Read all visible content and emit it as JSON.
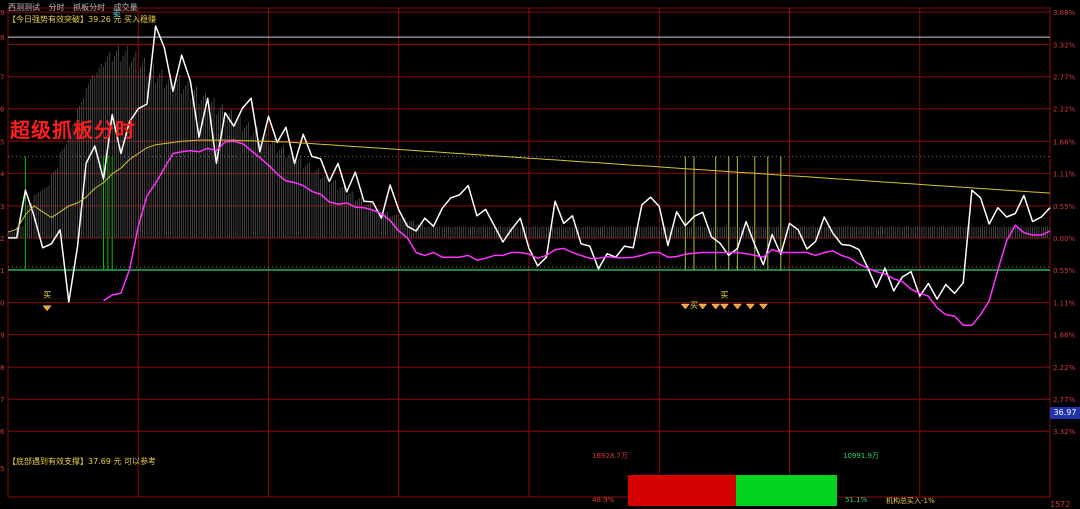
{
  "header": {
    "tab1": "西测测试",
    "tab2": "分时",
    "tab3": "抓板分时",
    "tab4": "成交量"
  },
  "signals": {
    "top": "【今日强势有效突破】39.26 元 买入稳赚",
    "bottom": "【底部遇到有效支撑】37.69 元 可以参考"
  },
  "overlay_title": "超级抓板分时",
  "price_tag": "36.97",
  "bottom_right": "1572",
  "colors": {
    "price": "#ffffff",
    "avg": "#ff33ff",
    "ma_slow": "#d4c233",
    "grid": "#8a0a0a",
    "buy": "#00e000",
    "sell": "#e00000"
  },
  "chart_data": {
    "type": "line",
    "x": [
      0,
      2,
      4,
      6,
      8,
      10,
      12,
      14,
      16,
      18,
      20,
      22,
      24,
      26,
      28,
      30,
      32,
      34,
      36,
      38,
      40,
      42,
      44,
      46,
      48,
      50,
      52,
      54,
      56,
      58,
      60,
      62,
      64,
      66,
      68,
      70,
      72,
      74,
      76,
      78,
      80,
      82,
      84,
      86,
      88,
      90,
      92,
      94,
      96,
      98,
      100,
      102,
      104,
      106,
      108,
      110,
      112,
      114,
      116,
      118,
      120,
      122,
      124,
      126,
      128,
      130,
      132,
      134,
      136,
      138,
      140,
      142,
      144,
      146,
      148,
      150,
      152,
      154,
      156,
      158,
      160,
      162,
      164,
      166,
      168,
      170,
      172,
      174,
      176,
      178,
      180,
      182,
      184,
      186,
      188,
      190,
      192,
      194,
      196,
      198,
      200,
      202,
      204,
      206,
      208,
      210,
      212,
      214,
      216,
      218,
      220,
      222,
      224,
      226,
      228,
      230,
      232,
      234,
      236,
      238,
      240
    ],
    "series": [
      {
        "values": [
          0.0,
          0.0,
          0.82,
          0.38,
          -0.17,
          -0.1,
          0.14,
          -1.1,
          -0.15,
          1.28,
          1.58,
          1.01,
          2.12,
          1.45,
          2.0,
          2.22,
          2.3,
          3.64,
          3.27,
          2.52,
          3.14,
          2.7,
          1.73,
          2.4,
          1.28,
          2.15,
          1.92,
          2.23,
          2.4,
          1.48,
          2.09,
          1.64,
          1.9,
          1.28,
          1.78,
          1.4,
          1.36,
          0.97,
          1.28,
          0.79,
          1.13,
          0.63,
          0.62,
          0.34,
          0.91,
          0.48,
          0.2,
          0.12,
          0.34,
          0.2,
          0.51,
          0.69,
          0.74,
          0.9,
          0.38,
          0.49,
          0.21,
          -0.07,
          0.15,
          0.34,
          -0.18,
          -0.48,
          -0.33,
          0.63,
          0.25,
          0.38,
          -0.1,
          -0.14,
          -0.53,
          -0.27,
          -0.33,
          -0.14,
          -0.17,
          0.57,
          0.7,
          0.54,
          -0.13,
          0.45,
          0.21,
          0.37,
          0.44,
          0.02,
          -0.09,
          -0.3,
          -0.18,
          0.28,
          -0.12,
          -0.46,
          0.06,
          -0.28,
          0.25,
          0.14,
          -0.19,
          -0.06,
          0.36,
          0.08,
          -0.11,
          -0.13,
          -0.2,
          -0.51,
          -0.85,
          -0.52,
          -0.91,
          -0.67,
          -0.58,
          -1.0,
          -0.78,
          -1.05,
          -0.8,
          -0.95,
          -0.77,
          0.82,
          0.69,
          0.24,
          0.52,
          0.36,
          0.42,
          0.73,
          0.28,
          0.36,
          0.52
        ]
      },
      {
        "values": [
          null,
          null,
          null,
          null,
          null,
          null,
          null,
          null,
          null,
          null,
          null,
          -1.08,
          -0.98,
          -0.95,
          -0.54,
          0.2,
          0.72,
          0.94,
          1.2,
          1.45,
          1.48,
          1.5,
          1.48,
          1.54,
          1.5,
          1.65,
          1.66,
          1.62,
          1.5,
          1.38,
          1.25,
          1.1,
          0.98,
          0.95,
          0.9,
          0.8,
          0.75,
          0.62,
          0.58,
          0.6,
          0.53,
          0.52,
          0.48,
          0.42,
          0.3,
          0.12,
          0.0,
          -0.25,
          -0.3,
          -0.25,
          -0.33,
          -0.33,
          -0.33,
          -0.3,
          -0.38,
          -0.35,
          -0.3,
          -0.3,
          -0.25,
          -0.25,
          -0.28,
          -0.35,
          -0.3,
          -0.2,
          -0.18,
          -0.25,
          -0.3,
          -0.35,
          -0.35,
          -0.32,
          -0.34,
          -0.34,
          -0.33,
          -0.3,
          -0.25,
          -0.25,
          -0.33,
          -0.32,
          -0.28,
          -0.26,
          -0.25,
          -0.25,
          -0.25,
          -0.25,
          -0.25,
          -0.27,
          -0.3,
          -0.33,
          -0.2,
          -0.25,
          -0.25,
          -0.25,
          -0.25,
          -0.3,
          -0.25,
          -0.22,
          -0.3,
          -0.35,
          -0.45,
          -0.52,
          -0.58,
          -0.62,
          -0.7,
          -0.75,
          -0.88,
          -0.95,
          -1.0,
          -1.2,
          -1.32,
          -1.34,
          -1.5,
          -1.5,
          -1.32,
          -1.08,
          -0.55,
          -0.05,
          0.22,
          0.09,
          0.05,
          0.05,
          0.12
        ]
      },
      {
        "values": [
          0.1,
          0.15,
          0.4,
          0.55,
          0.45,
          0.35,
          0.45,
          0.55,
          0.6,
          0.7,
          0.85,
          0.95,
          1.1,
          1.2,
          1.35,
          1.45,
          1.55,
          1.6,
          1.62,
          1.64,
          1.66,
          1.67,
          1.68,
          1.68,
          1.68,
          1.68,
          1.68,
          1.67,
          1.67,
          1.66,
          1.66,
          1.65,
          1.65,
          1.64,
          1.63,
          1.62,
          1.61,
          1.6,
          1.59,
          1.58,
          1.57,
          1.56,
          1.55,
          1.54,
          1.53,
          1.52,
          1.51,
          1.5,
          1.49,
          1.48,
          1.47,
          1.46,
          1.45,
          1.44,
          1.43,
          1.42,
          1.41,
          1.4,
          1.39,
          1.38,
          1.37,
          1.36,
          1.35,
          1.34,
          1.33,
          1.32,
          1.31,
          1.3,
          1.29,
          1.28,
          1.27,
          1.26,
          1.25,
          1.24,
          1.23,
          1.22,
          1.21,
          1.2,
          1.19,
          1.18,
          1.17,
          1.16,
          1.15,
          1.14,
          1.13,
          1.12,
          1.11,
          1.1,
          1.09,
          1.08,
          1.07,
          1.06,
          1.05,
          1.04,
          1.03,
          1.02,
          1.01,
          1.0,
          0.99,
          0.98,
          0.97,
          0.96,
          0.95,
          0.94,
          0.93,
          0.92,
          0.91,
          0.9,
          0.89,
          0.88,
          0.87,
          0.86,
          0.85,
          0.84,
          0.83,
          0.82,
          0.81,
          0.8,
          0.79,
          0.78,
          0.77
        ]
      }
    ],
    "volume_histogram": [
      0.1,
      0.2,
      0.6,
      0.8,
      0.9,
      1.2,
      1.6,
      2.0,
      2.4,
      2.8,
      3.0,
      3.2,
      3.3,
      3.3,
      3.2,
      3.1,
      3.0,
      2.9,
      2.8,
      2.8,
      2.7,
      2.6,
      2.5,
      2.4,
      2.3,
      2.2,
      2.1,
      2.0,
      1.9,
      1.8,
      1.7,
      1.6,
      1.5,
      1.4,
      1.3,
      1.2,
      1.1,
      1.0,
      0.9,
      0.8,
      0.7,
      0.6,
      0.5,
      0.45,
      0.4,
      0.35,
      0.3,
      0.25,
      0.2,
      0.2,
      0.2,
      0.2,
      0.2,
      0.2,
      0.2,
      0.2,
      0.2,
      0.2,
      0.2,
      0.2,
      0.2,
      0.2,
      0.2,
      0.2,
      0.2,
      0.2,
      0.2,
      0.2,
      0.2,
      0.2,
      0.2,
      0.2,
      0.2,
      0.2,
      0.2,
      0.2,
      0.2,
      0.2,
      0.2,
      0.2,
      0.2,
      0.2,
      0.2,
      0.2,
      0.2,
      0.2,
      0.2,
      0.2,
      0.2,
      0.2,
      0.2,
      0.2,
      0.2,
      0.2,
      0.2,
      0.2,
      0.2,
      0.2,
      0.2,
      0.2,
      0.2,
      0.2,
      0.2,
      0.2,
      0.2,
      0.2,
      0.2,
      0.2,
      0.2,
      0.2,
      0.2,
      0.2,
      0.2,
      0.2,
      0.2,
      0.2,
      0.2,
      0.2,
      0.2,
      0.2,
      0.2
    ],
    "ylim": [
      -4.45,
      3.95
    ],
    "right_ticks": [
      "3.88%",
      "3.32%",
      "2.77%",
      "2.22%",
      "1.66%",
      "1.11%",
      "0.55%",
      "0.00%",
      "0.55%",
      "1.11%",
      "1.66%",
      "2.22%",
      "2.77%",
      "3.32%"
    ],
    "right_tick_values": [
      3.88,
      3.32,
      2.77,
      2.22,
      1.66,
      1.11,
      0.55,
      0.0,
      -0.55,
      -1.11,
      -1.66,
      -2.22,
      -2.77,
      -3.32
    ],
    "left_ticks": [
      "9",
      "8",
      "7",
      "6",
      "5",
      "4",
      "3",
      "2",
      "1",
      "0",
      "9",
      "8",
      "7",
      "6",
      "5"
    ],
    "left_tick_values": [
      3.88,
      3.45,
      2.77,
      2.22,
      1.66,
      1.11,
      0.55,
      0.0,
      -0.55,
      -1.11,
      -1.66,
      -2.22,
      -2.77,
      -3.32,
      -3.95
    ],
    "resistance_line": 3.45,
    "support_line": -0.55,
    "dotted_lines": [
      1.4,
      -0.5
    ],
    "vertical_markers": [
      {
        "x": 4,
        "color": "#00c000"
      },
      {
        "x": 22,
        "color": "#00c000"
      },
      {
        "x": 23,
        "color": "#00c000"
      },
      {
        "x": 24,
        "color": "#00c000"
      },
      {
        "x": 156,
        "color": "#b8b830"
      },
      {
        "x": 158,
        "color": "#b8b830"
      },
      {
        "x": 163,
        "color": "#b8b830"
      },
      {
        "x": 166,
        "color": "#b8b830"
      },
      {
        "x": 168,
        "color": "#b8b830"
      },
      {
        "x": 172,
        "color": "#b8b830"
      },
      {
        "x": 175,
        "color": "#b8b830"
      },
      {
        "x": 178,
        "color": "#b8b830"
      }
    ],
    "annotations": [
      {
        "text": "卖",
        "x": 25,
        "y": 3.8,
        "color": "#3fd4ff"
      },
      {
        "text": "买",
        "x": 9,
        "y": -1.02,
        "color": "#e8d23a"
      },
      {
        "text": "买",
        "x": 158,
        "y": -1.2,
        "color": "#e8d23a"
      },
      {
        "text": "买",
        "x": 165,
        "y": -1.02,
        "color": "#e8d23a"
      }
    ],
    "diamonds": [
      {
        "x": 9,
        "y": -1.2
      },
      {
        "x": 156,
        "y": -1.17
      },
      {
        "x": 160,
        "y": -1.17
      },
      {
        "x": 163,
        "y": -1.17
      },
      {
        "x": 165,
        "y": -1.17
      },
      {
        "x": 168,
        "y": -1.17
      },
      {
        "x": 171,
        "y": -1.17
      },
      {
        "x": 174,
        "y": -1.17
      }
    ],
    "flow": {
      "sell_label": "16928.7万",
      "buy_label": "10991.9万",
      "sell_pct": "48.9%",
      "buy_pct": "51.1%",
      "inst_label": "机构总买入-1%"
    }
  }
}
